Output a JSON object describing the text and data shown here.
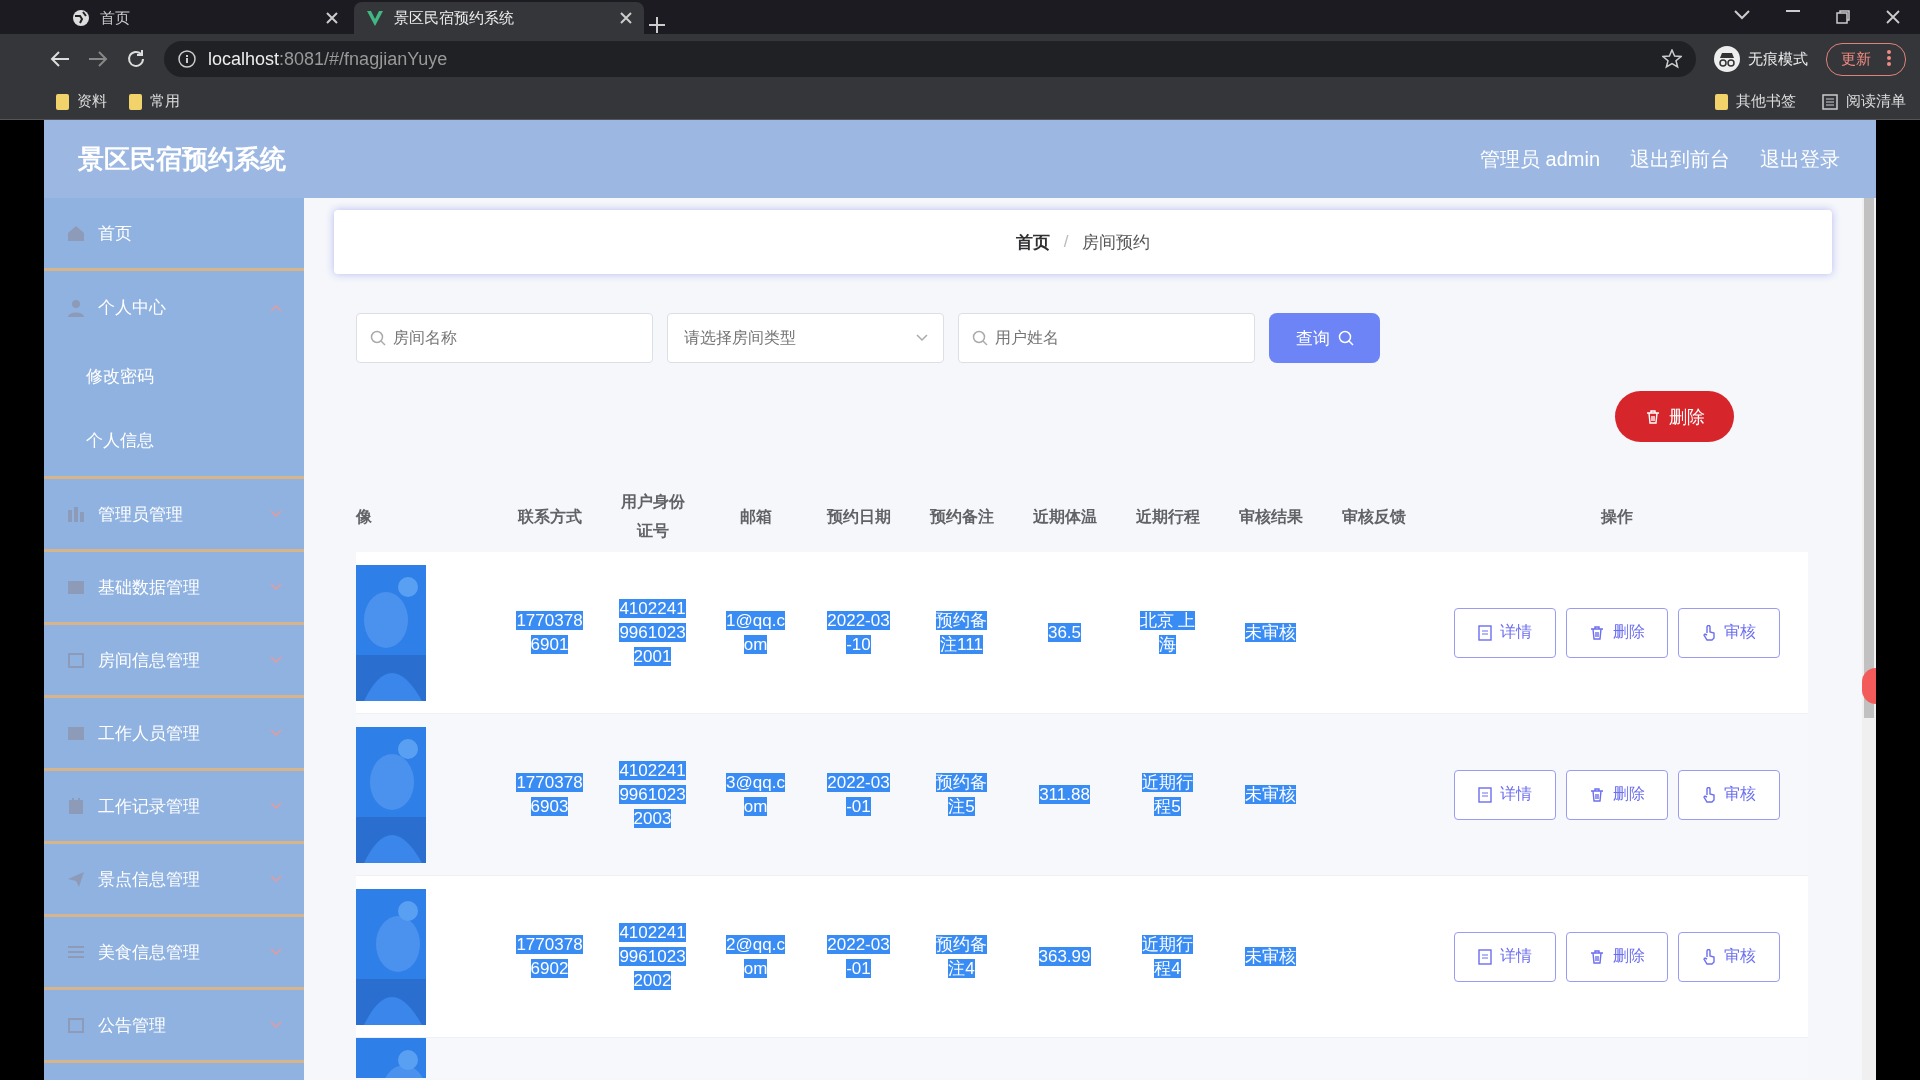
{
  "browser": {
    "tabs": [
      {
        "title": "首页",
        "selected": false
      },
      {
        "title": "景区民宿预约系统",
        "selected": true
      }
    ],
    "address": {
      "host": "localhost",
      "path": ":8081/#/fnagjianYuye"
    },
    "profile": "无痕模式",
    "update": "更新",
    "bookmarks": [
      "资料",
      "常用"
    ],
    "bookmarks_right": [
      "其他书签",
      "阅读清单"
    ]
  },
  "app": {
    "title": "景区民宿预约系统",
    "header_links": [
      "管理员 admin",
      "退出到前台",
      "退出登录"
    ]
  },
  "sidebar": {
    "items": [
      {
        "label": "首页"
      },
      {
        "label": "个人中心",
        "expanded": true,
        "children": [
          {
            "label": "修改密码"
          },
          {
            "label": "个人信息"
          }
        ]
      },
      {
        "label": "管理员管理",
        "expanded": false
      },
      {
        "label": "基础数据管理",
        "expanded": false
      },
      {
        "label": "房间信息管理",
        "expanded": false
      },
      {
        "label": "工作人员管理",
        "expanded": false
      },
      {
        "label": "工作记录管理",
        "expanded": false
      },
      {
        "label": "景点信息管理",
        "expanded": false
      },
      {
        "label": "美食信息管理",
        "expanded": false
      },
      {
        "label": "公告管理",
        "expanded": false
      }
    ]
  },
  "breadcrumb": {
    "items": [
      "首页",
      "房间预约"
    ],
    "separator": "/"
  },
  "search": {
    "fields": [
      {
        "kind": "input",
        "placeholder": "房间名称"
      },
      {
        "kind": "select",
        "placeholder": "请选择房间类型"
      },
      {
        "kind": "input",
        "placeholder": "用户姓名"
      }
    ],
    "button": "查询"
  },
  "delete_button": "删除",
  "table": {
    "selection_highlight": true,
    "columns": [
      "像",
      "联系方式",
      "用户身份证号",
      "邮箱",
      "预约日期",
      "预约备注",
      "近期体温",
      "近期行程",
      "审核结果",
      "审核反馈",
      "操作"
    ],
    "rows": [
      {
        "cells": [
          {
            "kind": "picture"
          },
          "17703786901",
          "410224199610232001",
          "1@qq.com",
          "2022-03-10",
          "预约备注111",
          "36.5",
          "北京 上海",
          "未审核",
          "",
          {
            "actions": [
              "详情",
              "删除",
              "审核"
            ]
          }
        ]
      },
      {
        "cells": [
          {
            "kind": "picture"
          },
          "17703786903",
          "410224199610232003",
          "3@qq.com",
          "2022-03-01",
          "预约备注5",
          "311.88",
          "近期行程5",
          "未审核",
          "",
          {
            "actions": [
              "详情",
              "删除",
              "审核"
            ]
          }
        ]
      },
      {
        "cells": [
          {
            "kind": "picture"
          },
          "17703786902",
          "410224199610232002",
          "2@qq.com",
          "2022-03-01",
          "预约备注4",
          "363.99",
          "近期行程4",
          "未审核",
          "",
          {
            "actions": [
              "详情",
              "删除",
              "审核"
            ]
          }
        ]
      }
    ],
    "partial_row": {
      "cells": [
        {
          "kind": "picture"
        }
      ]
    }
  }
}
